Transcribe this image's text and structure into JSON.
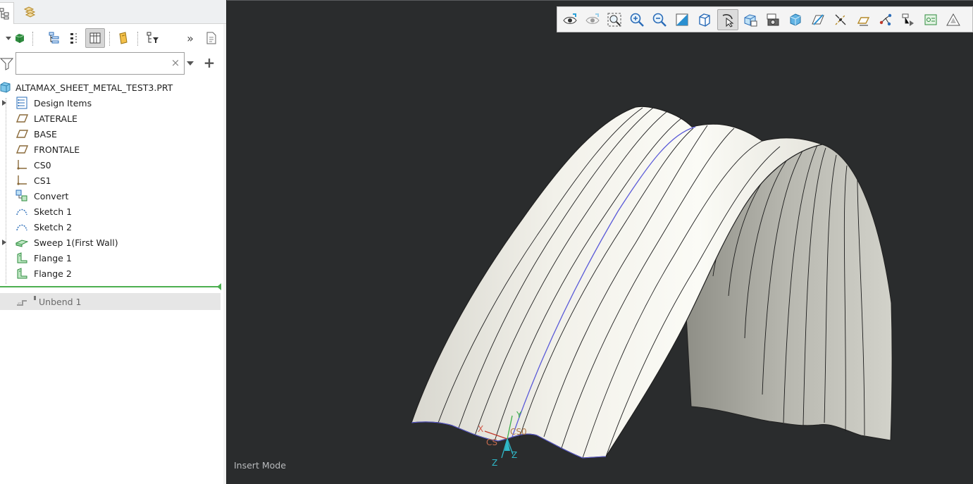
{
  "model_tree": {
    "root": {
      "label": "ALTAMAX_SHEET_METAL_TEST3.PRT",
      "icon": "part-icon"
    },
    "items": [
      {
        "label": "Design Items",
        "icon": "design-items-icon",
        "expandable": true
      },
      {
        "label": "LATERALE",
        "icon": "datum-plane-icon",
        "expandable": false
      },
      {
        "label": "BASE",
        "icon": "datum-plane-icon",
        "expandable": false
      },
      {
        "label": "FRONTALE",
        "icon": "datum-plane-icon",
        "expandable": false
      },
      {
        "label": "CS0",
        "icon": "csys-icon",
        "expandable": false
      },
      {
        "label": "CS1",
        "icon": "csys-icon",
        "expandable": false
      },
      {
        "label": "Convert",
        "icon": "convert-icon",
        "expandable": false
      },
      {
        "label": "Sketch 1",
        "icon": "sketch-icon",
        "expandable": false
      },
      {
        "label": "Sketch 2",
        "icon": "sketch-icon",
        "expandable": false
      },
      {
        "label": "Sweep 1(First Wall)",
        "icon": "sweep-wall-icon",
        "expandable": true
      },
      {
        "label": "Flange 1",
        "icon": "flange-icon",
        "expandable": false
      },
      {
        "label": "Flange 2",
        "icon": "flange-icon",
        "expandable": false
      }
    ],
    "after_insert": {
      "label": "Unbend 1",
      "icon": "unbend-icon",
      "suppressed": true
    }
  },
  "search": {
    "value": "",
    "placeholder": ""
  },
  "toolbar": {
    "more_label": "»"
  },
  "viewport": {
    "status": "Insert Mode",
    "csys_labels": {
      "x": "X",
      "y": "Y",
      "z": "Z",
      "z2": "Z",
      "cs": "CS",
      "cs0": "CS0"
    },
    "background_color": "#2a2c2d",
    "model_color": "#eeede6"
  },
  "colors": {
    "insert_indicator": "#4caf50",
    "selected_edge": "#5a5ad8",
    "axis_x": "#c0392b",
    "axis_y": "#3fae49",
    "axis_z": "#2fb8c8"
  }
}
